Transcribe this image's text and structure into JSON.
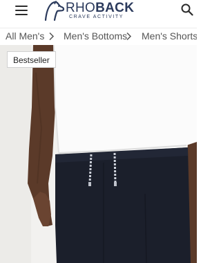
{
  "header": {
    "menu_icon": "hamburger-menu-icon",
    "logo": {
      "name_light": "RHO",
      "name_bold": "BACK",
      "tagline": "CRAVE ACTIVITY",
      "mark_icon": "dog-logo-icon",
      "color": "#2b3a5c"
    },
    "search_icon": "search-icon"
  },
  "breadcrumb": {
    "items": [
      {
        "label": "All Men's"
      },
      {
        "label": "Men's Bottoms"
      },
      {
        "label": "Men's Shorts"
      }
    ],
    "separator_icon": "chevron-right-icon"
  },
  "product": {
    "badge": "Bestseller",
    "image_description_icon": "product-photo-shorts"
  }
}
